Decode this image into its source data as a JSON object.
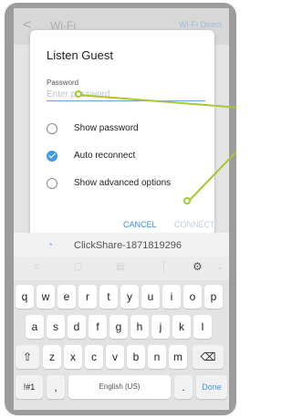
{
  "statusbar": {
    "back": "<",
    "title": "Wi-Fi",
    "direct": "Wi-Fi Direct"
  },
  "dialog": {
    "title": "Listen Guest",
    "password_label": "Password",
    "password_placeholder": "Enter password",
    "options": [
      {
        "label": "Show password",
        "checked": false
      },
      {
        "label": "Auto reconnect",
        "checked": true
      },
      {
        "label": "Show advanced options",
        "checked": false
      }
    ],
    "cancel": "CANCEL",
    "connect": "CONNECT"
  },
  "network_row": {
    "name": "ClickShare-1871819296"
  },
  "keyboard": {
    "row1": [
      "q",
      "w",
      "e",
      "r",
      "t",
      "y",
      "u",
      "i",
      "o",
      "p"
    ],
    "row2": [
      "a",
      "s",
      "d",
      "f",
      "g",
      "h",
      "j",
      "k",
      "l"
    ],
    "row3": [
      "⇧",
      "z",
      "x",
      "c",
      "v",
      "b",
      "n",
      "m",
      "⌫"
    ],
    "row4_left": "!#1",
    "row4_comma": ",",
    "row4_space": "English (US)",
    "row4_period": ".",
    "row4_done": "Done",
    "settings_icon": "gear-icon"
  },
  "colors": {
    "accent": "#3e9be6",
    "callout": "#a6c832"
  }
}
